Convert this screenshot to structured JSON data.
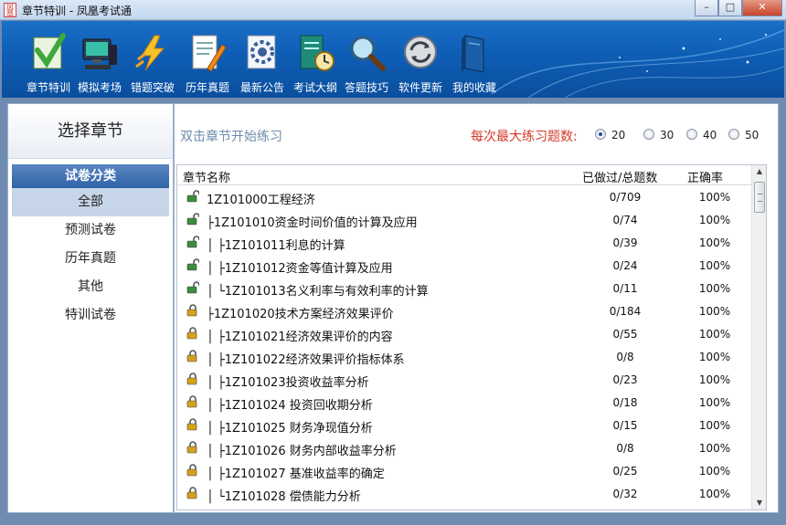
{
  "window": {
    "title": "章节特训 - 凤凰考试通",
    "icon_text": "凤凰",
    "minimize": "–",
    "maximize": "□",
    "close": "✕"
  },
  "toolbar": {
    "items": [
      {
        "label": "章节特训",
        "icon": "chapter-training-icon"
      },
      {
        "label": "模拟考场",
        "icon": "mock-exam-icon"
      },
      {
        "label": "错题突破",
        "icon": "wrong-question-icon"
      },
      {
        "label": "历年真题",
        "icon": "past-papers-icon"
      },
      {
        "label": "最新公告",
        "icon": "announcement-icon"
      },
      {
        "label": "考试大纲",
        "icon": "syllabus-icon"
      },
      {
        "label": "答题技巧",
        "icon": "tips-icon"
      },
      {
        "label": "软件更新",
        "icon": "update-icon"
      },
      {
        "label": "我的收藏",
        "icon": "favorites-icon"
      }
    ]
  },
  "sidebar": {
    "title": "选择章节",
    "category_header": "试卷分类",
    "items": [
      {
        "label": "全部",
        "active": true
      },
      {
        "label": "预测试卷"
      },
      {
        "label": "历年真题"
      },
      {
        "label": "其他"
      },
      {
        "label": "特训试卷"
      }
    ]
  },
  "main": {
    "hint": "双击章节开始练习",
    "max_label": "每次最大练习题数:",
    "options": [
      {
        "value": "20",
        "selected": true
      },
      {
        "value": "30"
      },
      {
        "value": "40"
      },
      {
        "value": "50"
      }
    ],
    "table": {
      "headers": {
        "name": "章节名称",
        "done": "已做过/总题数",
        "accuracy": "正确率"
      },
      "rows": [
        {
          "name": "1Z101000工程经济",
          "done": "0/709",
          "accuracy": "100%",
          "unlocked": true
        },
        {
          "name": "├1Z101010资金时间价值的计算及应用",
          "done": "0/74",
          "accuracy": "100%",
          "unlocked": true
        },
        {
          "name": "│ ├1Z101011利息的计算",
          "done": "0/39",
          "accuracy": "100%",
          "unlocked": true
        },
        {
          "name": "│ ├1Z101012资金等值计算及应用",
          "done": "0/24",
          "accuracy": "100%",
          "unlocked": true
        },
        {
          "name": "│ └1Z101013名义利率与有效利率的计算",
          "done": "0/11",
          "accuracy": "100%",
          "unlocked": true
        },
        {
          "name": "├1Z101020技术方案经济效果评价",
          "done": "0/184",
          "accuracy": "100%",
          "unlocked": false
        },
        {
          "name": "│ ├1Z101021经济效果评价的内容",
          "done": "0/55",
          "accuracy": "100%",
          "unlocked": false
        },
        {
          "name": "│ ├1Z101022经济效果评价指标体系",
          "done": "0/8",
          "accuracy": "100%",
          "unlocked": false
        },
        {
          "name": "│ ├1Z101023投资收益率分析",
          "done": "0/23",
          "accuracy": "100%",
          "unlocked": false
        },
        {
          "name": "│ ├1Z101024 投资回收期分析",
          "done": "0/18",
          "accuracy": "100%",
          "unlocked": false
        },
        {
          "name": "│ ├1Z101025 财务净现值分析",
          "done": "0/15",
          "accuracy": "100%",
          "unlocked": false
        },
        {
          "name": "│ ├1Z101026 财务内部收益率分析",
          "done": "0/8",
          "accuracy": "100%",
          "unlocked": false
        },
        {
          "name": "│ ├1Z101027 基准收益率的确定",
          "done": "0/25",
          "accuracy": "100%",
          "unlocked": false
        },
        {
          "name": "│ └1Z101028 偿债能力分析",
          "done": "0/32",
          "accuracy": "100%",
          "unlocked": false
        }
      ]
    }
  },
  "colors": {
    "toolbar": "#0e5db5",
    "accent_red": "#d23b2a",
    "hint": "#6d8aad",
    "category": "#2f62a8"
  }
}
